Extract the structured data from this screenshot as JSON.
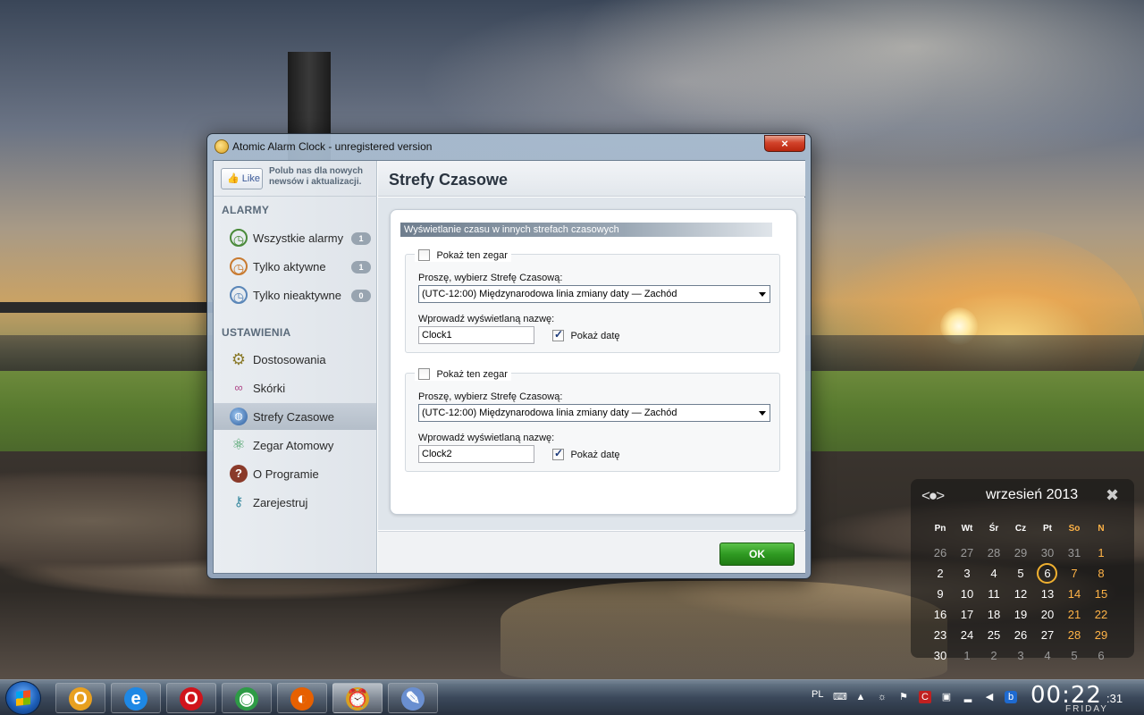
{
  "window": {
    "title": "Atomic Alarm Clock - unregistered version",
    "close_label": "×"
  },
  "sidebar": {
    "like": {
      "button_label": "Like",
      "text": "Polub nas dla nowych newsów i aktualizacji."
    },
    "sections": [
      {
        "heading": "ALARMY",
        "items": [
          {
            "label": "Wszystkie alarmy",
            "badge": "1",
            "icon": "clock-icon"
          },
          {
            "label": "Tylko aktywne",
            "badge": "1",
            "icon": "alarm-clock-icon"
          },
          {
            "label": "Tylko nieaktywne",
            "badge": "0",
            "icon": "clock-inactive-icon"
          }
        ]
      },
      {
        "heading": "USTAWIENIA",
        "items": [
          {
            "label": "Dostosowania",
            "icon": "gear-icon"
          },
          {
            "label": "Skórki",
            "icon": "glasses-icon"
          },
          {
            "label": "Strefy Czasowe",
            "icon": "globe-icon",
            "selected": true
          },
          {
            "label": "Zegar Atomowy",
            "icon": "atom-icon"
          },
          {
            "label": "O Programie",
            "icon": "question-icon"
          },
          {
            "label": "Zarejestruj",
            "icon": "key-icon"
          }
        ]
      }
    ]
  },
  "main": {
    "title": "Strefy Czasowe",
    "panel_heading": "Wyświetlanie czasu w innych strefach czasowych",
    "clocks": [
      {
        "show_label": "Pokaż ten zegar",
        "show_checked": false,
        "zone_label": "Proszę, wybierz Strefę Czasową:",
        "zone_value": "(UTC-12:00) Międzynarodowa linia zmiany daty — Zachód",
        "name_label": "Wprowadź wyświetlaną nazwę:",
        "name_value": "Clock1",
        "date_label": "Pokaż datę",
        "date_checked": true
      },
      {
        "show_label": "Pokaż ten zegar",
        "show_checked": false,
        "zone_label": "Proszę, wybierz Strefę Czasową:",
        "zone_value": "(UTC-12:00) Międzynarodowa linia zmiany daty — Zachód",
        "name_label": "Wprowadź wyświetlaną nazwę:",
        "name_value": "Clock2",
        "date_label": "Pokaż datę",
        "date_checked": true
      }
    ],
    "ok_label": "OK"
  },
  "calendar": {
    "nav": "<●>",
    "title": "wrzesień 2013",
    "close": "✖",
    "weekdays": [
      "Pn",
      "Wt",
      "Śr",
      "Cz",
      "Pt",
      "So",
      "N"
    ],
    "weeks": [
      [
        "26",
        "27",
        "28",
        "29",
        "30",
        "31",
        "1"
      ],
      [
        "2",
        "3",
        "4",
        "5",
        "6",
        "7",
        "8"
      ],
      [
        "9",
        "10",
        "11",
        "12",
        "13",
        "14",
        "15"
      ],
      [
        "16",
        "17",
        "18",
        "19",
        "20",
        "21",
        "22"
      ],
      [
        "23",
        "24",
        "25",
        "26",
        "27",
        "28",
        "29"
      ],
      [
        "30",
        "1",
        "2",
        "3",
        "4",
        "5",
        "6"
      ]
    ],
    "today": "6"
  },
  "taskbar": {
    "apps": [
      {
        "name": "outlook",
        "glyph": "O",
        "color": "#e8a020"
      },
      {
        "name": "internet-explorer",
        "glyph": "e",
        "color": "#1e88e5"
      },
      {
        "name": "opera",
        "glyph": "O",
        "color": "#d0141c"
      },
      {
        "name": "chrome",
        "glyph": "◉",
        "color": "#2e9b46"
      },
      {
        "name": "firefox",
        "glyph": "◐",
        "color": "#e66000"
      },
      {
        "name": "atomic-alarm-clock",
        "glyph": "⏰",
        "color": "#d8a020",
        "active": true
      },
      {
        "name": "paint",
        "glyph": "✎",
        "color": "#6a8fd0"
      }
    ],
    "tray": {
      "language": "PL",
      "time": "00:22",
      "seconds": ":31",
      "day": "FRIDAY"
    }
  },
  "colors": {
    "ok_green": "#2f9a22",
    "weekend": "#ffb347",
    "today_ring": "#f0b030"
  }
}
